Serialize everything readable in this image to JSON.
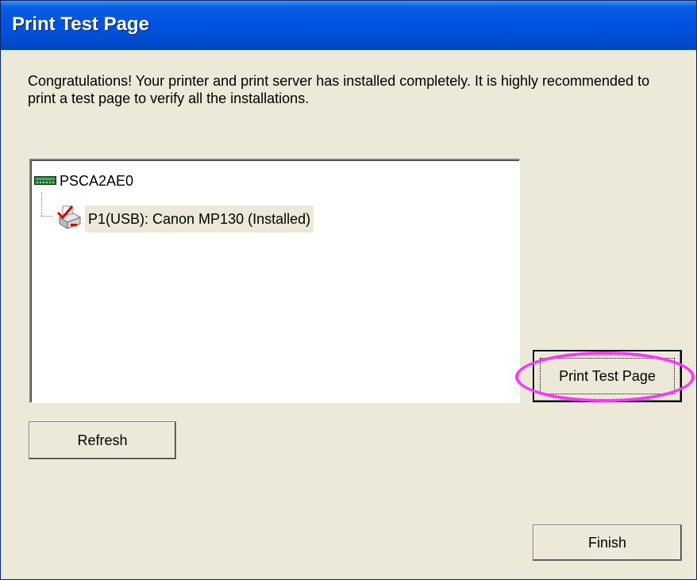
{
  "window": {
    "title": "Print Test Page"
  },
  "intro_text": "Congratulations! Your printer and print server has installed completely. It is highly recommended to print a test page to verify all the installations.",
  "tree": {
    "root": {
      "label": "PSCA2AE0",
      "icon": "print-server-icon"
    },
    "children": [
      {
        "label": "P1(USB): Canon MP130 (Installed)",
        "icon": "printer-installed-icon"
      }
    ]
  },
  "buttons": {
    "print_test_page": "Print Test Page",
    "refresh": "Refresh",
    "finish": "Finish"
  },
  "colors": {
    "titlebar": "#0054e3",
    "window_background": "#ece9d8",
    "highlight_oval": "#ff33ff"
  }
}
